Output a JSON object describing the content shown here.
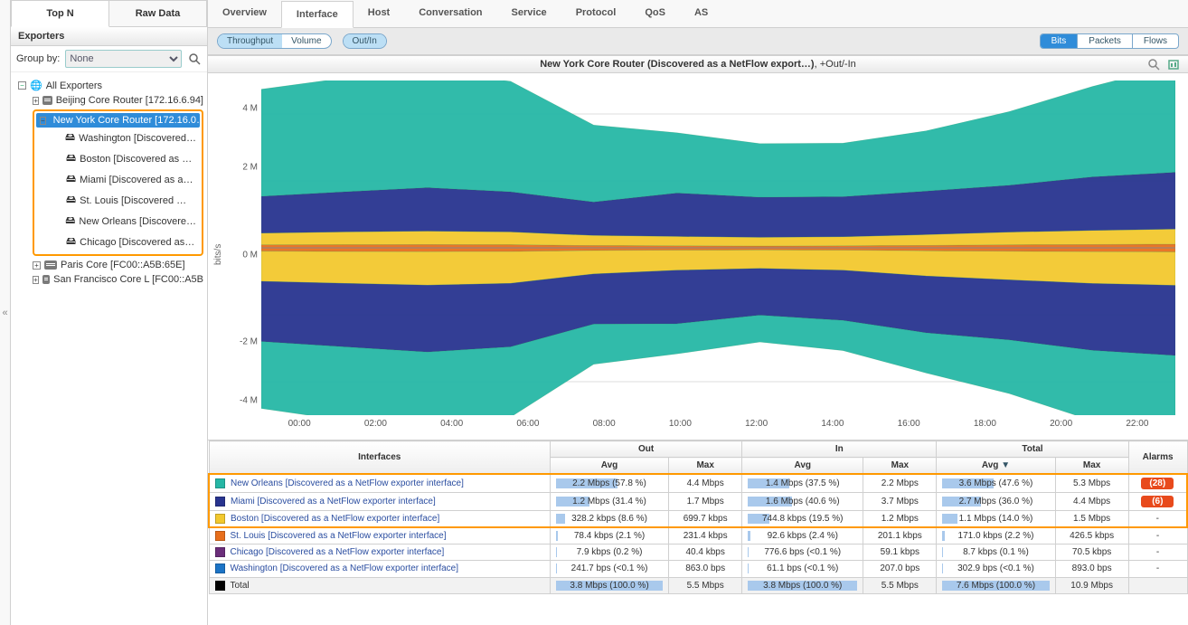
{
  "leftTabs": [
    "Top N",
    "Raw Data"
  ],
  "leftActiveTab": 0,
  "sectionHeader": "Exporters",
  "groupByLabel": "Group by:",
  "groupByValue": "None",
  "tree": {
    "root": "All Exporters",
    "nodes": [
      {
        "label": "Beijing Core Router [172.16.6.94]",
        "exp": "+"
      },
      {
        "label": "New York Core Router [172.16.0…",
        "exp": "−",
        "sel": true,
        "children": [
          "Washington [Discovered…",
          "Boston [Discovered as …",
          "Miami [Discovered as a…",
          "St. Louis [Discovered …",
          "New Orleans [Discovere…",
          "Chicago [Discovered as…"
        ]
      },
      {
        "label": "Paris Core [FC00::A5B:65E]",
        "exp": "+"
      },
      {
        "label": "San Francisco Core L [FC00::A5B",
        "exp": "+"
      }
    ]
  },
  "topTabs": [
    "Overview",
    "Interface",
    "Host",
    "Conversation",
    "Service",
    "Protocol",
    "QoS",
    "AS"
  ],
  "topActiveTab": 1,
  "toolbar": {
    "seg1": [
      "Throughput",
      "Volume"
    ],
    "seg1Active": 0,
    "seg2": [
      "Out/In"
    ],
    "seg2Active": 0,
    "units": [
      "Bits",
      "Packets",
      "Flows"
    ],
    "unitsActive": 0
  },
  "chart": {
    "titleMain": "New York Core Router (Discovered as a NetFlow export…)",
    "titleSuffix": ", +Out/-In",
    "ylabel": "bits/s",
    "yticks": [
      "4 M",
      "2 M",
      "0 M",
      "-2 M",
      "-4 M"
    ],
    "xticks": [
      "00:00",
      "02:00",
      "04:00",
      "06:00",
      "08:00",
      "10:00",
      "12:00",
      "14:00",
      "16:00",
      "18:00",
      "20:00",
      "22:00"
    ]
  },
  "chart_data": {
    "type": "area",
    "ylabel": "bits/s",
    "ylim": [
      -5000000,
      5000000
    ],
    "x": [
      "00:00",
      "02:00",
      "04:00",
      "06:00",
      "08:00",
      "10:00",
      "12:00",
      "14:00",
      "16:00",
      "18:00",
      "20:00",
      "22:00"
    ],
    "series": [
      {
        "name": "New Orleans",
        "color": "#26b7a5",
        "out": [
          3200000,
          3400000,
          3500000,
          3300000,
          2300000,
          1800000,
          1600000,
          1600000,
          1800000,
          2200000,
          2700000,
          3200000
        ],
        "in": [
          -2000000,
          -2200000,
          -2300000,
          -2100000,
          -1200000,
          -900000,
          -800000,
          -900000,
          -1200000,
          -1600000,
          -2100000,
          -2400000
        ]
      },
      {
        "name": "Miami",
        "color": "#28348f",
        "out": [
          1100000,
          1200000,
          1300000,
          1200000,
          1000000,
          1300000,
          1200000,
          1200000,
          1300000,
          1400000,
          1600000,
          1700000
        ],
        "in": [
          -1800000,
          -1900000,
          -2000000,
          -1900000,
          -1500000,
          -1600000,
          -1400000,
          -1500000,
          -1700000,
          -1800000,
          -2000000,
          -2100000
        ]
      },
      {
        "name": "Boston",
        "color": "#f2c82e",
        "out": [
          350000,
          380000,
          400000,
          380000,
          300000,
          280000,
          260000,
          270000,
          320000,
          380000,
          420000,
          450000
        ],
        "in": [
          -900000,
          -950000,
          -1000000,
          -950000,
          -700000,
          -600000,
          -550000,
          -600000,
          -750000,
          -850000,
          -950000,
          -1000000
        ]
      },
      {
        "name": "St. Louis",
        "color": "#e86f1c",
        "out": [
          90000,
          95000,
          100000,
          95000,
          70000,
          60000,
          55000,
          60000,
          75000,
          90000,
          100000,
          110000
        ],
        "in": [
          -100000,
          -110000,
          -115000,
          -110000,
          -80000,
          -70000,
          -65000,
          -70000,
          -90000,
          -105000,
          -115000,
          -120000
        ]
      }
    ]
  },
  "tableGroups": [
    "Out",
    "In",
    "Total"
  ],
  "tableHeaders": {
    "iface": "Interfaces",
    "avg": "Avg",
    "max": "Max",
    "alarms": "Alarms"
  },
  "rows": [
    {
      "hl": true,
      "color": "#26b7a5",
      "name": "New Orleans [Discovered as a NetFlow exporter interface]",
      "outAvg": "2.2 Mbps (57.8 %)",
      "outAvgPct": 57.8,
      "outMax": "4.4 Mbps",
      "inAvg": "1.4 Mbps (37.5 %)",
      "inAvgPct": 37.5,
      "inMax": "2.2 Mbps",
      "totAvg": "3.6 Mbps (47.6 %)",
      "totAvgPct": 47.6,
      "totMax": "5.3 Mbps",
      "alarm": "(28)"
    },
    {
      "hl": true,
      "color": "#28348f",
      "name": "Miami [Discovered as a NetFlow exporter interface]",
      "outAvg": "1.2 Mbps (31.4 %)",
      "outAvgPct": 31.4,
      "outMax": "1.7 Mbps",
      "inAvg": "1.6 Mbps (40.6 %)",
      "inAvgPct": 40.6,
      "inMax": "3.7 Mbps",
      "totAvg": "2.7 Mbps (36.0 %)",
      "totAvgPct": 36.0,
      "totMax": "4.4 Mbps",
      "alarm": "(6)"
    },
    {
      "hl": true,
      "color": "#f2c82e",
      "name": "Boston [Discovered as a NetFlow exporter interface]",
      "outAvg": "328.2 kbps (8.6 %)",
      "outAvgPct": 8.6,
      "outMax": "699.7 kbps",
      "inAvg": "744.8 kbps (19.5 %)",
      "inAvgPct": 19.5,
      "inMax": "1.2 Mbps",
      "totAvg": "1.1 Mbps (14.0 %)",
      "totAvgPct": 14.0,
      "totMax": "1.5 Mbps",
      "alarm": "-"
    },
    {
      "color": "#e86f1c",
      "name": "St. Louis [Discovered as a NetFlow exporter interface]",
      "outAvg": "78.4 kbps (2.1 %)",
      "outAvgPct": 2.1,
      "outMax": "231.4 kbps",
      "inAvg": "92.6 kbps (2.4 %)",
      "inAvgPct": 2.4,
      "inMax": "201.1 kbps",
      "totAvg": "171.0 kbps (2.2 %)",
      "totAvgPct": 2.2,
      "totMax": "426.5 kbps",
      "alarm": "-"
    },
    {
      "color": "#6b2e7a",
      "name": "Chicago [Discovered as a NetFlow exporter interface]",
      "outAvg": "7.9 kbps (0.2 %)",
      "outAvgPct": 0.2,
      "outMax": "40.4 kbps",
      "inAvg": "776.6 bps (<0.1 %)",
      "inAvgPct": 0.1,
      "inMax": "59.1 kbps",
      "totAvg": "8.7 kbps (0.1 %)",
      "totAvgPct": 0.1,
      "totMax": "70.5 kbps",
      "alarm": "-"
    },
    {
      "color": "#1c74c6",
      "name": "Washington [Discovered as a NetFlow exporter interface]",
      "outAvg": "241.7 bps (<0.1 %)",
      "outAvgPct": 0.1,
      "outMax": "863.0 bps",
      "inAvg": "61.1 bps (<0.1 %)",
      "inAvgPct": 0.1,
      "inMax": "207.0 bps",
      "totAvg": "302.9 bps (<0.1 %)",
      "totAvgPct": 0.1,
      "totMax": "893.0 bps",
      "alarm": "-"
    }
  ],
  "totalRow": {
    "color": "#000",
    "name": "Total",
    "outAvg": "3.8 Mbps (100.0 %)",
    "outAvgPct": 100,
    "outMax": "5.5 Mbps",
    "inAvg": "3.8 Mbps (100.0 %)",
    "inAvgPct": 100,
    "inMax": "5.5 Mbps",
    "totAvg": "7.6 Mbps (100.0 %)",
    "totAvgPct": 100,
    "totMax": "10.9 Mbps",
    "alarm": ""
  }
}
